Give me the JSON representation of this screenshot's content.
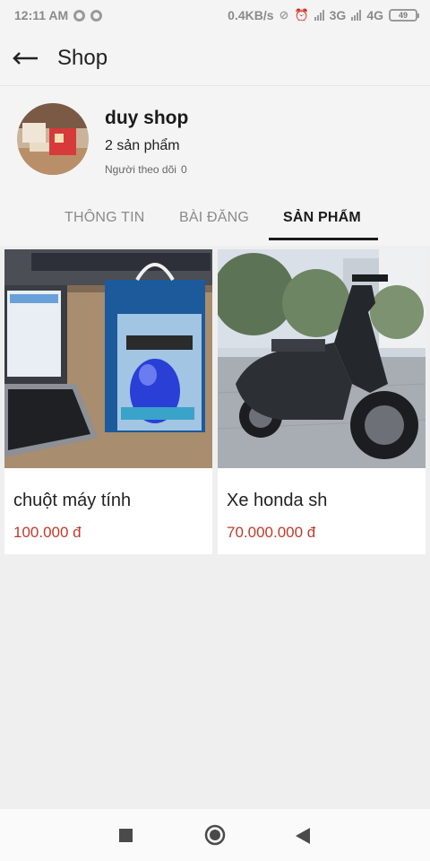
{
  "status_bar": {
    "time": "12:11 AM",
    "speed": "0.4KB/s",
    "network1": "3G",
    "network2": "4G",
    "battery": "49"
  },
  "app_bar": {
    "title": "Shop"
  },
  "shop": {
    "name": "duy shop",
    "product_count": "2 sản phẩm",
    "followers_label": "Người theo dõi",
    "followers_count": "0"
  },
  "tabs": [
    {
      "label": "THÔNG TIN",
      "active": false
    },
    {
      "label": "BÀI ĐĂNG",
      "active": false
    },
    {
      "label": "SẢN PHẨM",
      "active": true
    }
  ],
  "products": [
    {
      "name": "chuột máy tính",
      "price": "100.000 đ",
      "image": "computer-mouse-photo"
    },
    {
      "name": "Xe honda sh",
      "price": "70.000.000 đ",
      "image": "scooter-photo"
    }
  ],
  "colors": {
    "price": "#c0392b",
    "active_tab": "#1a1a1a",
    "inactive_tab": "#8a8a8a"
  }
}
